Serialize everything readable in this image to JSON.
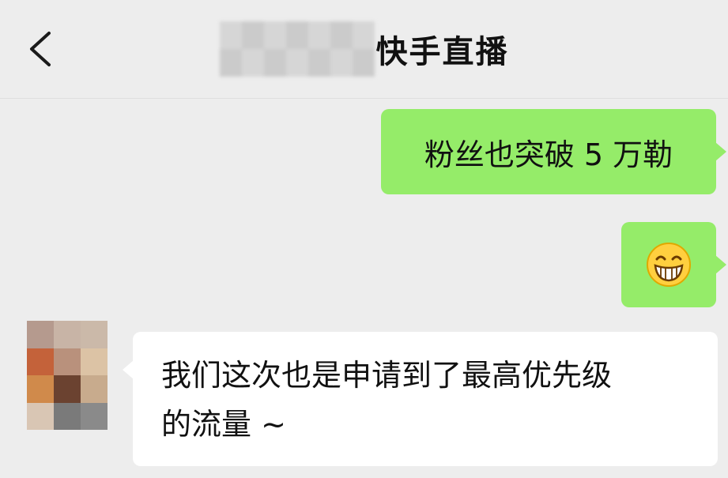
{
  "header": {
    "title": "快手直播",
    "back_icon": "chevron-left-icon"
  },
  "messages": [
    {
      "side": "right",
      "type": "text",
      "text": "粉丝也突破 5 万勒"
    },
    {
      "side": "right",
      "type": "emoji",
      "emoji": "grinning-face-icon"
    },
    {
      "side": "left",
      "type": "text",
      "lines": [
        "我们这次也是申请到了最高优先级",
        "的流量 ~"
      ]
    }
  ],
  "colors": {
    "background": "#ededed",
    "sent_bubble": "#95ec69",
    "received_bubble": "#ffffff"
  }
}
